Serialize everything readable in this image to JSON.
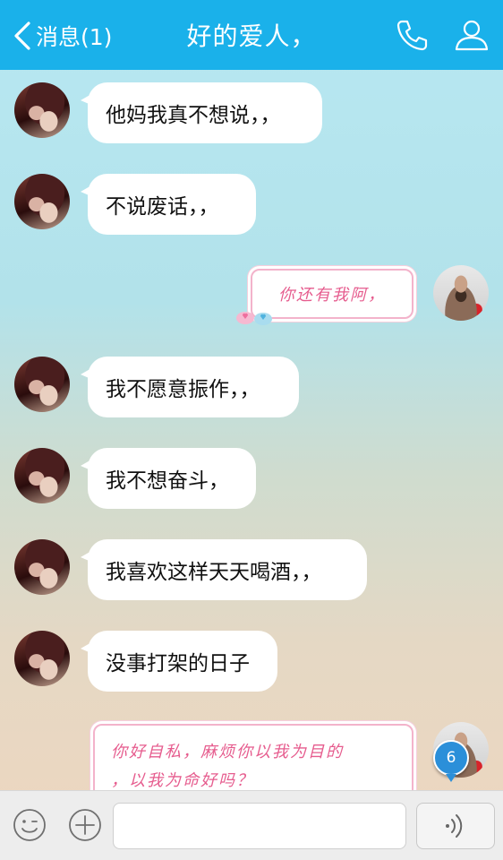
{
  "header": {
    "back_label": "消息(1)",
    "title": "好的爱人，",
    "phone_icon": "phone-icon",
    "profile_icon": "person-icon",
    "bg_color": "#1ab1ea"
  },
  "messages": [
    {
      "from": "contact",
      "text": "他妈我真不想说，，"
    },
    {
      "from": "contact",
      "text": "不说废话，，"
    },
    {
      "from": "me",
      "text": "你还有我阿，"
    },
    {
      "from": "contact",
      "text": "我不愿意振作，，"
    },
    {
      "from": "contact",
      "text": "我不想奋斗，"
    },
    {
      "from": "contact",
      "text": "我喜欢这样天天喝酒，，"
    },
    {
      "from": "contact",
      "text": "没事打架的日子"
    },
    {
      "from": "me",
      "text_line1": "你好自私，麻烦你以我为目的",
      "text_line2": "，以我为命好吗？"
    }
  ],
  "unread_badge": "6",
  "input": {
    "emoji_icon": "smiley-icon",
    "plus_icon": "plus-icon",
    "voice_icon": "voice-icon",
    "value": ""
  }
}
